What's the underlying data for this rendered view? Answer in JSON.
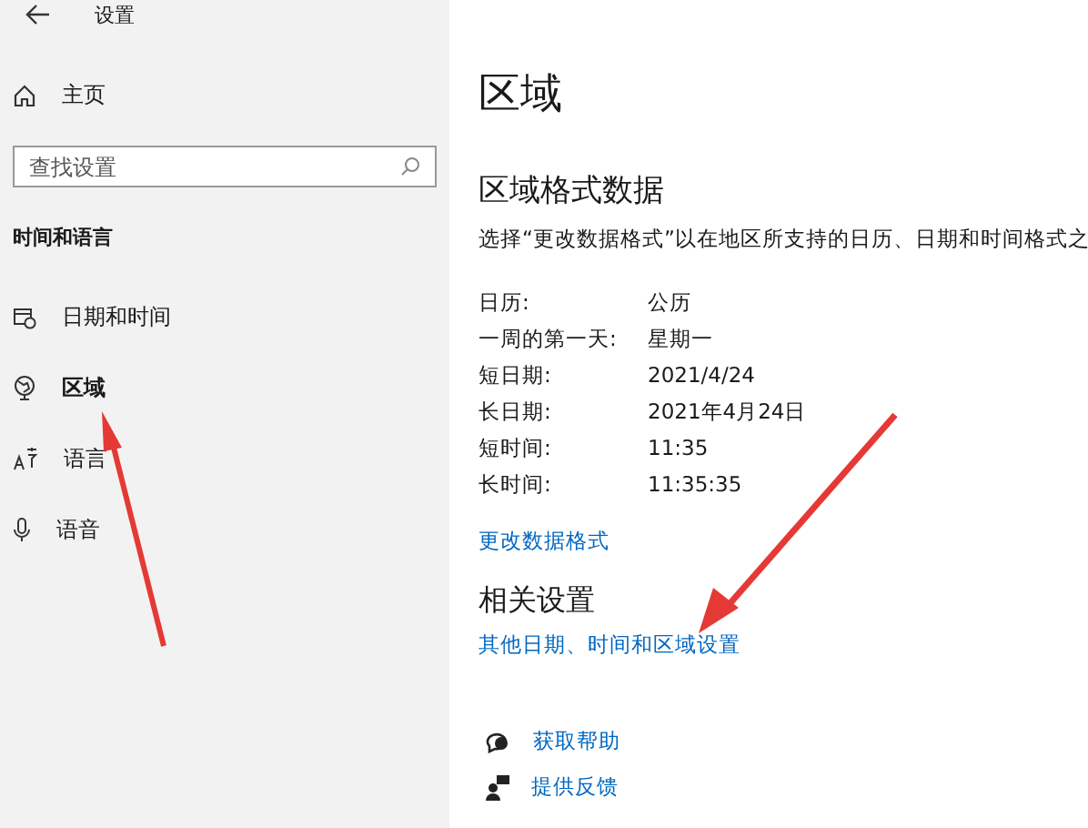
{
  "window": {
    "title": "设置"
  },
  "sidebar": {
    "home": "主页",
    "search": {
      "placeholder": "查找设置"
    },
    "section": "时间和语言",
    "items": [
      {
        "kind": "calendar",
        "label": "日期和时间",
        "selected": false
      },
      {
        "kind": "globe",
        "label": "区域",
        "selected": true
      },
      {
        "kind": "language",
        "label": "语言",
        "selected": false
      },
      {
        "kind": "mic",
        "label": "语音",
        "selected": false
      }
    ]
  },
  "content": {
    "title": "区域",
    "format_heading": "区域格式数据",
    "format_description": "选择“更改数据格式”以在地区所支持的日历、日期和时间格式之",
    "formats": [
      {
        "label": "日历:",
        "value": "公历"
      },
      {
        "label": "一周的第一天:",
        "value": "星期一"
      },
      {
        "label": "短日期:",
        "value": "2021/4/24"
      },
      {
        "label": "长日期:",
        "value": "2021年4月24日"
      },
      {
        "label": "短时间:",
        "value": "11:35"
      },
      {
        "label": "长时间:",
        "value": "11:35:35"
      }
    ],
    "change_link": "更改数据格式",
    "related_heading": "相关设置",
    "related_link": "其他日期、时间和区域设置",
    "help_links": [
      {
        "kind": "help",
        "label": "获取帮助"
      },
      {
        "kind": "feedback",
        "label": "提供反馈"
      }
    ]
  }
}
